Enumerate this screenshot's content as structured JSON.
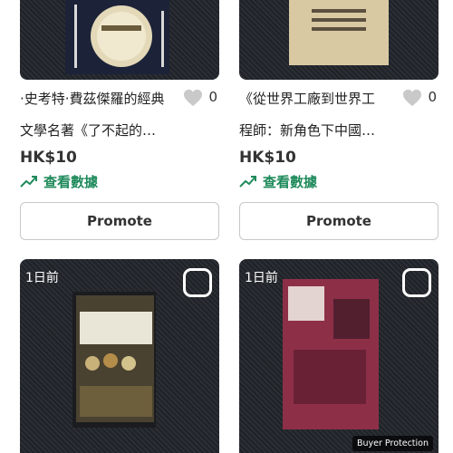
{
  "listings": [
    {
      "title_line1": "·史考特·費茲傑羅的經典",
      "title_line2": "文學名著《了不起的…",
      "likes": "0",
      "price": "HK$10",
      "stats_label": "查看數據",
      "promote_label": "Promote"
    },
    {
      "title_line1": "《從世界工廠到世界工",
      "title_line2": "程師：新角色下中國…",
      "likes": "0",
      "price": "HK$10",
      "stats_label": "查看數據",
      "promote_label": "Promote"
    },
    {
      "time_label": "1日前"
    },
    {
      "time_label": "1日前",
      "badge": "Buyer Protection"
    }
  ],
  "colors": {
    "accent_green": "#1f8a5b",
    "heart_gray": "#c9c9c9",
    "photo_dark": "#2b2f35"
  }
}
